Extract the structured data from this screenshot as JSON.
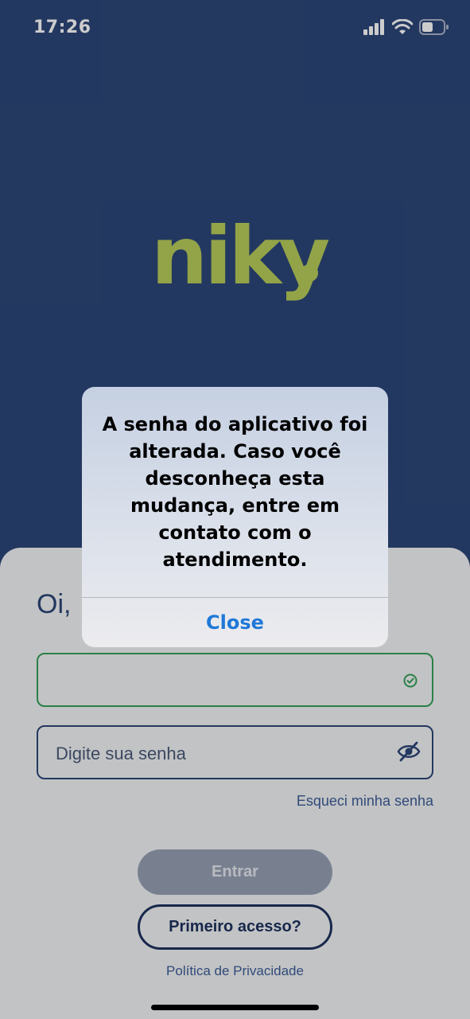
{
  "status_bar": {
    "time": "17:26",
    "icons": [
      "signal-icon",
      "wifi-icon",
      "battery-icon"
    ]
  },
  "logo": {
    "text": "niky"
  },
  "login": {
    "greeting": "Oi,",
    "username_value": "",
    "password_placeholder": "Digite sua senha",
    "forgot_password": "Esqueci minha senha",
    "enter_button": "Entrar",
    "first_access_button": "Primeiro acesso?",
    "privacy_link": "Política de Privacidade"
  },
  "alert": {
    "message": "A senha do aplicativo foi alterada. Caso você desconheça esta mudança, entre em contato com o atendimento.",
    "close_button": "Close"
  },
  "colors": {
    "header_bg": "#2c4778",
    "logo": "#b8cc5a",
    "success_border": "#35a15a",
    "link": "#3c5d99",
    "alert_action": "#1f78d8"
  }
}
